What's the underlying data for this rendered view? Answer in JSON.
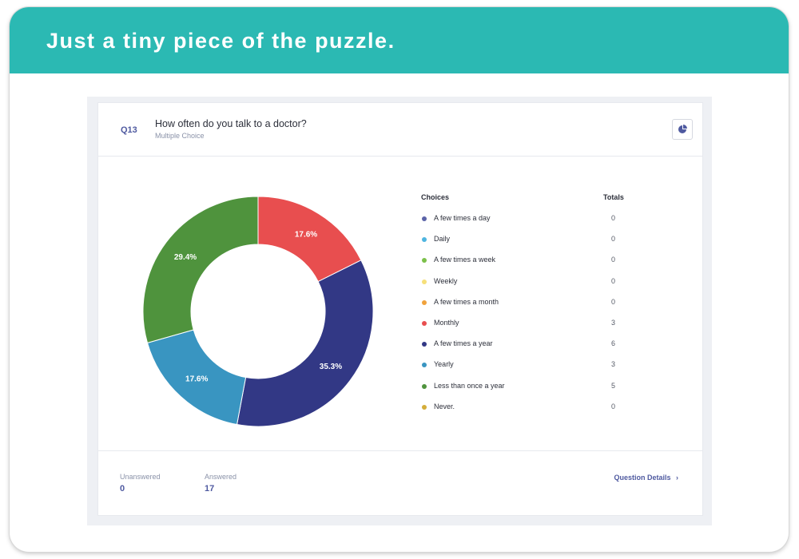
{
  "banner": {
    "title": "Just a tiny piece of the puzzle."
  },
  "question": {
    "number": "Q13",
    "title": "How often do you talk to a doctor?",
    "type": "Multiple Choice"
  },
  "legend": {
    "choices_header": "Choices",
    "totals_header": "Totals"
  },
  "chart_data": {
    "type": "pie",
    "donut": true,
    "categories": [
      "A few times a day",
      "Daily",
      "A few times a week",
      "Weekly",
      "A few times a month",
      "Monthly",
      "A few times a year",
      "Yearly",
      "Less than once a year",
      "Never."
    ],
    "values": [
      0,
      0,
      0,
      0,
      0,
      3,
      6,
      3,
      5,
      0
    ],
    "colors": [
      "#5b63a8",
      "#4eb5e0",
      "#7cc04a",
      "#f6e07a",
      "#f0a23c",
      "#e84e4f",
      "#323885",
      "#3995c1",
      "#4f933d",
      "#d4ad3a"
    ],
    "slice_labels": [
      "",
      "",
      "",
      "",
      "",
      "17.6%",
      "35.3%",
      "17.6%",
      "29.4%",
      ""
    ]
  },
  "footer": {
    "unanswered_label": "Unanswered",
    "unanswered_value": "0",
    "answered_label": "Answered",
    "answered_value": "17",
    "details_link": "Question Details"
  }
}
